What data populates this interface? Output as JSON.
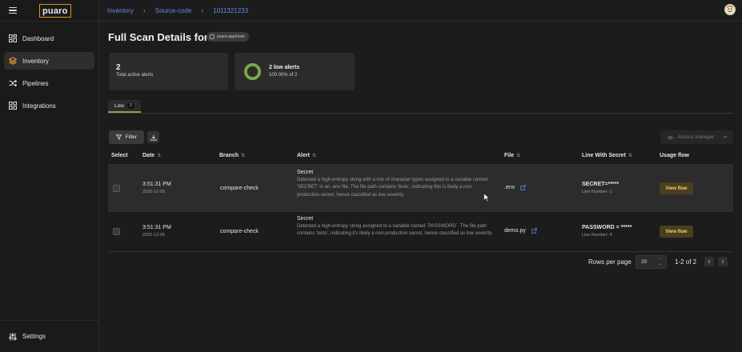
{
  "app": {
    "logo_text": "puaro"
  },
  "breadcrumbs": [
    {
      "label": "Inventory"
    },
    {
      "label": "Source-code"
    },
    {
      "label": "1011321233"
    }
  ],
  "sidebar": {
    "items": [
      {
        "label": "Dashboard",
        "icon": "dashboard-grid-icon",
        "active": false
      },
      {
        "label": "Inventory",
        "icon": "layers-icon",
        "active": true
      },
      {
        "label": "Pipelines",
        "icon": "shuffle-icon",
        "active": false
      },
      {
        "label": "Integrations",
        "icon": "integrations-icon",
        "active": false
      }
    ],
    "settings_label": "Settings"
  },
  "page": {
    "title": "Full Scan Details for",
    "repo_chip": "puaro-app/tests"
  },
  "cards": {
    "active": {
      "count": "2",
      "label": "Total active alerts"
    },
    "low": {
      "title": "2 low alerts",
      "subtitle": "100.00% of 2",
      "fraction": 1.0
    }
  },
  "tabs": [
    {
      "label": "Low",
      "badge": "2",
      "active": true
    }
  ],
  "toolbar": {
    "filter_label": "Filter",
    "actions_label": "Actions manager"
  },
  "table": {
    "columns": [
      {
        "label": "Select",
        "sort": ""
      },
      {
        "label": "Date",
        "sort": "⇅"
      },
      {
        "label": "Branch",
        "sort": "⇅"
      },
      {
        "label": "Alert",
        "sort": "⇅"
      },
      {
        "label": "File",
        "sort": "⇅"
      },
      {
        "label": "Line With Secret",
        "sort": "⇅"
      },
      {
        "label": "Usage flow",
        "sort": ""
      }
    ],
    "rows": [
      {
        "time": "3:51:31 PM",
        "date": "2025-12-05",
        "branch": "compare-check",
        "alert_title": "Secret",
        "alert_desc": "Detected a high-entropy string with a mix of character types assigned to a variable named 'SECRET' in an .env file. The file path contains 'tests', indicating this is likely a non-production secret, hence classified as low severity.",
        "file": ".env",
        "secret": "SECRET=*****",
        "line_number": "Line Number: 1",
        "action": "View flow"
      },
      {
        "time": "3:51:31 PM",
        "date": "2025-12-05",
        "branch": "compare-check",
        "alert_title": "Secret",
        "alert_desc": "Detected a high-entropy string assigned to a variable named `PASSWORD`. The file path contains 'tests', indicating it's likely a non-production secret, hence classified as low severity.",
        "file": "demo.py",
        "secret": "PASSWORD = *****",
        "line_number": "Line Number: 4",
        "action": "View flow"
      }
    ]
  },
  "pagination": {
    "rows_per_page_label": "Rows per page",
    "rows_per_page_value": "20",
    "range": "1-2 of 2"
  },
  "colors": {
    "accent_blue": "#5b8fe8",
    "logo_orange": "#d9911f",
    "low_green": "#7aa84a",
    "view_flow_bg": "#4a3f1e",
    "view_flow_text": "#f0d47a"
  }
}
